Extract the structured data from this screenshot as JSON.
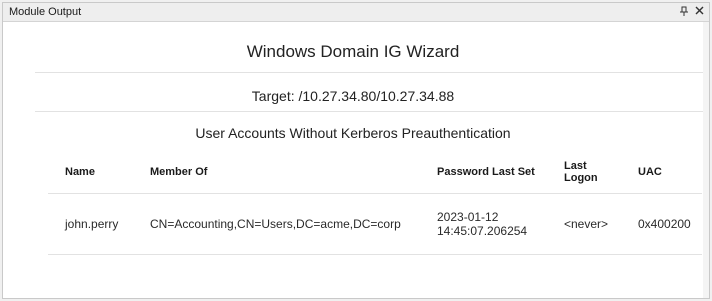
{
  "window": {
    "title": "Module Output",
    "pin_glyph": "⍄",
    "close_glyph": "✕"
  },
  "report": {
    "heading": "Windows Domain IG Wizard",
    "target": "Target: /10.27.34.80/10.27.34.88",
    "section_title": "User Accounts Without Kerberos Preauthentication"
  },
  "table": {
    "headers": {
      "name": "Name",
      "member_of": "Member Of",
      "password_last_set": "Password Last Set",
      "last_logon": "Last Logon",
      "uac": "UAC"
    },
    "rows": [
      {
        "name": "john.perry",
        "member_of": "CN=Accounting,CN=Users,DC=acme,DC=corp",
        "password_last_set": "2023-01-12 14:45:07.206254",
        "last_logon": "<never>",
        "uac": "0x400200"
      }
    ]
  }
}
